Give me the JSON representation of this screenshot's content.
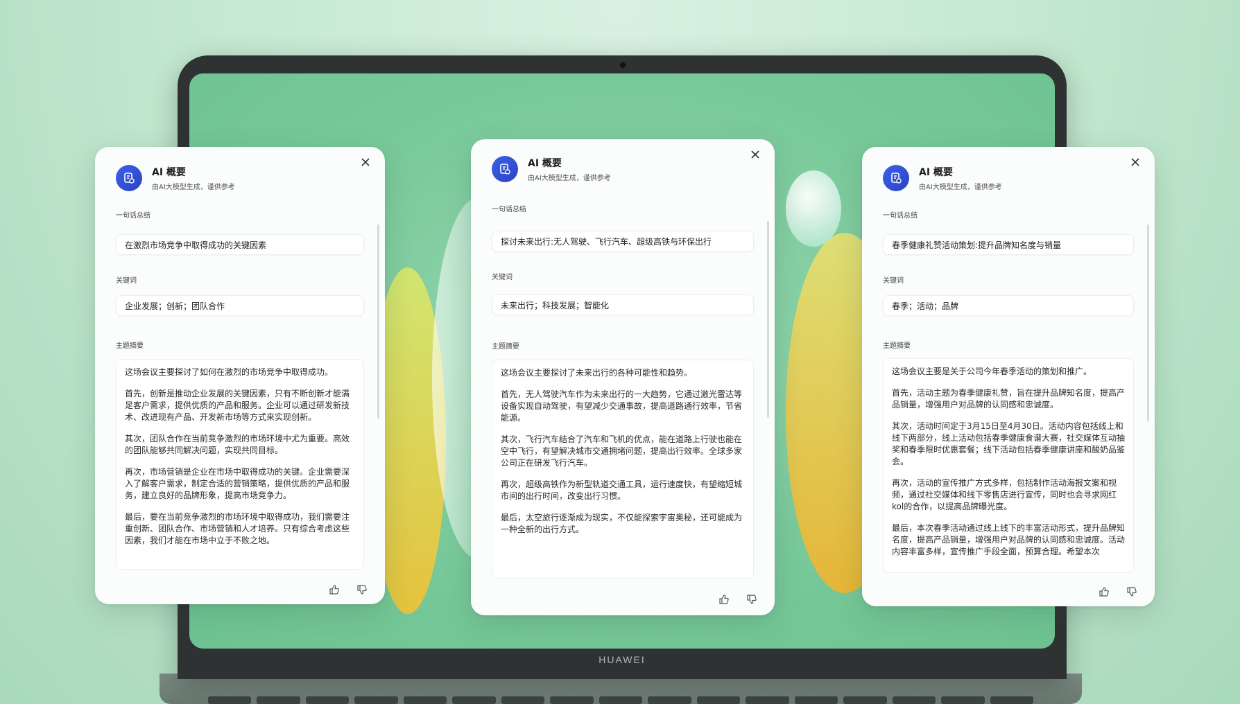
{
  "laptop": {
    "brand": "HUAWEI"
  },
  "panels": [
    {
      "title": "AI 概要",
      "subtitle": "由AI大模型生成，谨供参考",
      "sentence_label": "一句话总结",
      "sentence": "在激烈市场竞争中取得成功的关键因素",
      "keywords_label": "关键词",
      "keywords": "企业发展；创新；团队合作",
      "summary_label": "主题摘要",
      "summary": [
        "这场会议主要探讨了如何在激烈的市场竞争中取得成功。",
        "首先，创新是推动企业发展的关键因素，只有不断创新才能满足客户需求，提供优质的产品和服务。企业可以通过研发新技术、改进现有产品、开发新市场等方式来实现创新。",
        "其次，团队合作在当前竞争激烈的市场环境中尤为重要。高效的团队能够共同解决问题，实现共同目标。",
        "再次，市场营销是企业在市场中取得成功的关键。企业需要深入了解客户需求，制定合适的营销策略，提供优质的产品和服务，建立良好的品牌形象，提高市场竞争力。",
        "最后，要在当前竞争激烈的市场环境中取得成功，我们需要注重创新、团队合作、市场营销和人才培养。只有综合考虑这些因素，我们才能在市场中立于不败之地。"
      ]
    },
    {
      "title": "AI 概要",
      "subtitle": "由AI大模型生成，谨供参考",
      "sentence_label": "一句话总结",
      "sentence": "探讨未来出行:无人驾驶、飞行汽车、超级高铁与环保出行",
      "keywords_label": "关键词",
      "keywords": "未来出行；科技发展；智能化",
      "summary_label": "主题摘要",
      "summary": [
        "这场会议主要探讨了未来出行的各种可能性和趋势。",
        "首先，无人驾驶汽车作为未来出行的一大趋势，它通过激光雷达等设备实现自动驾驶，有望减少交通事故，提高道路通行效率，节省能源。",
        "其次，飞行汽车结合了汽车和飞机的优点，能在道路上行驶也能在空中飞行，有望解决城市交通拥堵问题，提高出行效率。全球多家公司正在研发飞行汽车。",
        "再次，超级高铁作为新型轨道交通工具，运行速度快，有望缩短城市间的出行时间，改变出行习惯。",
        "最后，太空旅行逐渐成为现实，不仅能探索宇宙奥秘，还可能成为一种全新的出行方式。"
      ]
    },
    {
      "title": "AI 概要",
      "subtitle": "由AI大模型生成，谨供参考",
      "sentence_label": "一句话总结",
      "sentence": "春季健康礼赞活动策划:提升品牌知名度与销量",
      "keywords_label": "关键词",
      "keywords": "春季；活动；品牌",
      "summary_label": "主题摘要",
      "summary": [
        "这场会议主要是关于公司今年春季活动的策划和推广。",
        "首先，活动主题为春季健康礼赞，旨在提升品牌知名度，提高产品销量，增强用户对品牌的认同感和忠诚度。",
        "其次，活动时间定于3月15日至4月30日。活动内容包括线上和线下两部分，线上活动包括春季健康食谱大赛，社交媒体互动抽奖和春季限时优惠套餐；线下活动包括春季健康讲座和酸奶品鉴会。",
        "再次，活动的宣传推广方式多样，包括制作活动海报文案和视频，通过社交媒体和线下零售店进行宣传，同时也会寻求网红kol的合作，以提高品牌曝光度。",
        "最后，本次春季活动通过线上线下的丰富活动形式，提升品牌知名度，提高产品销量，增强用户对品牌的认同感和忠诚度。活动内容丰富多样，宣传推广手段全面，预算合理。希望本次"
      ]
    }
  ]
}
